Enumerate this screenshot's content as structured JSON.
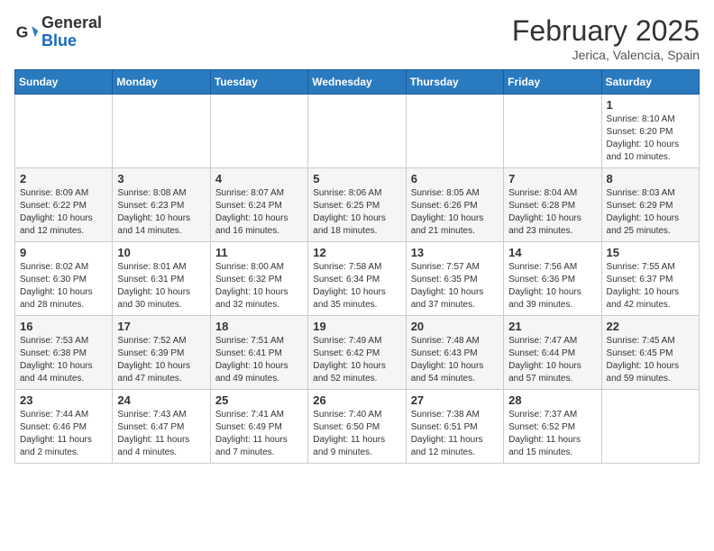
{
  "logo": {
    "line1": "General",
    "line2": "Blue"
  },
  "header": {
    "month": "February 2025",
    "location": "Jerica, Valencia, Spain"
  },
  "weekdays": [
    "Sunday",
    "Monday",
    "Tuesday",
    "Wednesday",
    "Thursday",
    "Friday",
    "Saturday"
  ],
  "weeks": [
    [
      {
        "day": "",
        "info": ""
      },
      {
        "day": "",
        "info": ""
      },
      {
        "day": "",
        "info": ""
      },
      {
        "day": "",
        "info": ""
      },
      {
        "day": "",
        "info": ""
      },
      {
        "day": "",
        "info": ""
      },
      {
        "day": "1",
        "info": "Sunrise: 8:10 AM\nSunset: 6:20 PM\nDaylight: 10 hours and 10 minutes."
      }
    ],
    [
      {
        "day": "2",
        "info": "Sunrise: 8:09 AM\nSunset: 6:22 PM\nDaylight: 10 hours and 12 minutes."
      },
      {
        "day": "3",
        "info": "Sunrise: 8:08 AM\nSunset: 6:23 PM\nDaylight: 10 hours and 14 minutes."
      },
      {
        "day": "4",
        "info": "Sunrise: 8:07 AM\nSunset: 6:24 PM\nDaylight: 10 hours and 16 minutes."
      },
      {
        "day": "5",
        "info": "Sunrise: 8:06 AM\nSunset: 6:25 PM\nDaylight: 10 hours and 18 minutes."
      },
      {
        "day": "6",
        "info": "Sunrise: 8:05 AM\nSunset: 6:26 PM\nDaylight: 10 hours and 21 minutes."
      },
      {
        "day": "7",
        "info": "Sunrise: 8:04 AM\nSunset: 6:28 PM\nDaylight: 10 hours and 23 minutes."
      },
      {
        "day": "8",
        "info": "Sunrise: 8:03 AM\nSunset: 6:29 PM\nDaylight: 10 hours and 25 minutes."
      }
    ],
    [
      {
        "day": "9",
        "info": "Sunrise: 8:02 AM\nSunset: 6:30 PM\nDaylight: 10 hours and 28 minutes."
      },
      {
        "day": "10",
        "info": "Sunrise: 8:01 AM\nSunset: 6:31 PM\nDaylight: 10 hours and 30 minutes."
      },
      {
        "day": "11",
        "info": "Sunrise: 8:00 AM\nSunset: 6:32 PM\nDaylight: 10 hours and 32 minutes."
      },
      {
        "day": "12",
        "info": "Sunrise: 7:58 AM\nSunset: 6:34 PM\nDaylight: 10 hours and 35 minutes."
      },
      {
        "day": "13",
        "info": "Sunrise: 7:57 AM\nSunset: 6:35 PM\nDaylight: 10 hours and 37 minutes."
      },
      {
        "day": "14",
        "info": "Sunrise: 7:56 AM\nSunset: 6:36 PM\nDaylight: 10 hours and 39 minutes."
      },
      {
        "day": "15",
        "info": "Sunrise: 7:55 AM\nSunset: 6:37 PM\nDaylight: 10 hours and 42 minutes."
      }
    ],
    [
      {
        "day": "16",
        "info": "Sunrise: 7:53 AM\nSunset: 6:38 PM\nDaylight: 10 hours and 44 minutes."
      },
      {
        "day": "17",
        "info": "Sunrise: 7:52 AM\nSunset: 6:39 PM\nDaylight: 10 hours and 47 minutes."
      },
      {
        "day": "18",
        "info": "Sunrise: 7:51 AM\nSunset: 6:41 PM\nDaylight: 10 hours and 49 minutes."
      },
      {
        "day": "19",
        "info": "Sunrise: 7:49 AM\nSunset: 6:42 PM\nDaylight: 10 hours and 52 minutes."
      },
      {
        "day": "20",
        "info": "Sunrise: 7:48 AM\nSunset: 6:43 PM\nDaylight: 10 hours and 54 minutes."
      },
      {
        "day": "21",
        "info": "Sunrise: 7:47 AM\nSunset: 6:44 PM\nDaylight: 10 hours and 57 minutes."
      },
      {
        "day": "22",
        "info": "Sunrise: 7:45 AM\nSunset: 6:45 PM\nDaylight: 10 hours and 59 minutes."
      }
    ],
    [
      {
        "day": "23",
        "info": "Sunrise: 7:44 AM\nSunset: 6:46 PM\nDaylight: 11 hours and 2 minutes."
      },
      {
        "day": "24",
        "info": "Sunrise: 7:43 AM\nSunset: 6:47 PM\nDaylight: 11 hours and 4 minutes."
      },
      {
        "day": "25",
        "info": "Sunrise: 7:41 AM\nSunset: 6:49 PM\nDaylight: 11 hours and 7 minutes."
      },
      {
        "day": "26",
        "info": "Sunrise: 7:40 AM\nSunset: 6:50 PM\nDaylight: 11 hours and 9 minutes."
      },
      {
        "day": "27",
        "info": "Sunrise: 7:38 AM\nSunset: 6:51 PM\nDaylight: 11 hours and 12 minutes."
      },
      {
        "day": "28",
        "info": "Sunrise: 7:37 AM\nSunset: 6:52 PM\nDaylight: 11 hours and 15 minutes."
      },
      {
        "day": "",
        "info": ""
      }
    ]
  ]
}
